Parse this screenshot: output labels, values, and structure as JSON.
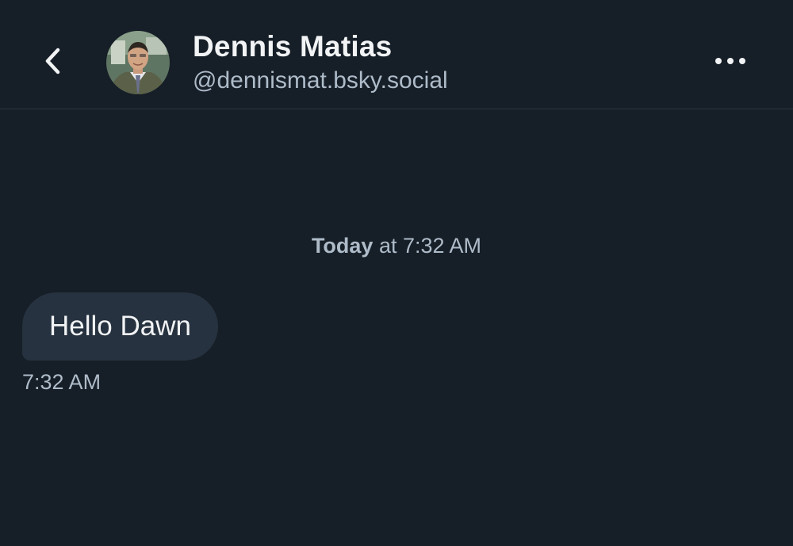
{
  "header": {
    "back_icon": "chevron-left-icon",
    "avatar_icon": "profile-photo",
    "display_name": "Dennis Matias",
    "handle": "@dennismat.bsky.social",
    "more_icon": "ellipsis-horizontal-icon"
  },
  "conversation": {
    "date_separator": {
      "day": "Today",
      "rest": " at 7:32 AM"
    },
    "messages": [
      {
        "text": "Hello Dawn",
        "time": "7:32 AM"
      }
    ]
  },
  "colors": {
    "background": "#161e27",
    "bubble": "#26323f",
    "primary_text": "#f1f3f5",
    "secondary_text": "#aebbc9",
    "divider": "#2c3440"
  }
}
